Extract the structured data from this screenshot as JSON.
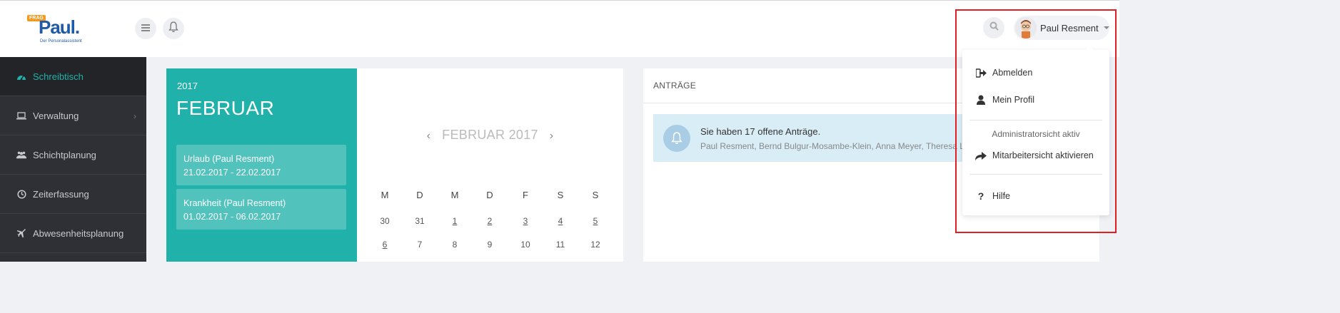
{
  "header": {
    "logo": {
      "badge": "FRAG",
      "name": "Paul.",
      "tagline": "Der Personalassistent"
    },
    "menu_icon": "hamburger-icon",
    "notifications_icon": "bell-icon",
    "search_icon": "search-icon",
    "user_name": "Paul Resment"
  },
  "sidebar": {
    "items": [
      {
        "label": "Schreibtisch",
        "icon": "dashboard-icon",
        "active": true
      },
      {
        "label": "Verwaltung",
        "icon": "laptop-icon",
        "has_submenu": true
      },
      {
        "label": "Schichtplanung",
        "icon": "users-icon"
      },
      {
        "label": "Zeiterfassung",
        "icon": "clock-icon"
      },
      {
        "label": "Abwesenheitsplanung",
        "icon": "plane-icon"
      }
    ],
    "submenu_chevron": "›"
  },
  "calendar": {
    "year": "2017",
    "month": "FEBRUAR",
    "nav_title": "FEBRUAR 2017",
    "prev": "‹",
    "next": "›",
    "events": [
      {
        "title": "Urlaub (Paul Resment)",
        "dates": "21.02.2017 - 22.02.2017"
      },
      {
        "title": "Krankheit (Paul Resment)",
        "dates": "01.02.2017 - 06.02.2017"
      }
    ],
    "weekdays": [
      "M",
      "D",
      "M",
      "D",
      "F",
      "S",
      "S"
    ],
    "rows": [
      [
        {
          "d": "30",
          "link": false
        },
        {
          "d": "31",
          "link": false
        },
        {
          "d": "1",
          "link": true
        },
        {
          "d": "2",
          "link": true
        },
        {
          "d": "3",
          "link": true
        },
        {
          "d": "4",
          "link": true
        },
        {
          "d": "5",
          "link": true
        }
      ],
      [
        {
          "d": "6",
          "link": true
        },
        {
          "d": "7",
          "link": false
        },
        {
          "d": "8",
          "link": false
        },
        {
          "d": "9",
          "link": false
        },
        {
          "d": "10",
          "link": false
        },
        {
          "d": "11",
          "link": false
        },
        {
          "d": "12",
          "link": false
        }
      ]
    ]
  },
  "requests": {
    "title": "ANTRÄGE",
    "alert_title": "Sie haben 17 offene Anträge.",
    "alert_names": "Paul Resment, Bernd Bulgur-Mosambe-Klein, Anna Meyer, Theresa Leis"
  },
  "user_menu": {
    "logout": "Abmelden",
    "profile": "Mein Profil",
    "admin_view_label": "Administratorsicht aktiv",
    "employee_view": "Mitarbeitersicht aktivieren",
    "help": "Hilfe"
  },
  "colors": {
    "accent": "#20b2aa",
    "sidebar_bg": "#2e3035",
    "highlight": "#e02020"
  }
}
